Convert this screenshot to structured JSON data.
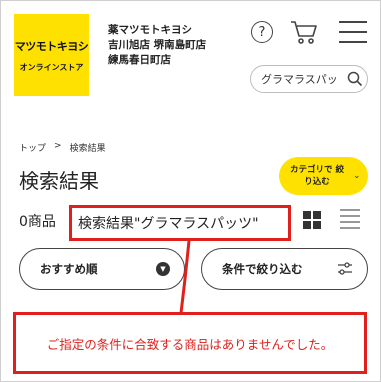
{
  "header": {
    "logo": {
      "brand": "マツモトキヨシ",
      "sub": "オンラインストア"
    },
    "store_lines": [
      "薬マツモトキヨシ",
      "吉川旭店 堺南島町店",
      "練馬春日町店"
    ],
    "icons": {
      "help": "help-icon",
      "cart": "cart-icon",
      "menu": "hamburger-menu-icon",
      "search": "search-icon"
    },
    "help_glyph": "?",
    "search": {
      "value": "グラマラスパッ"
    }
  },
  "breadcrumb": {
    "home": "トップ",
    "separator": ">",
    "current": "検索結果"
  },
  "title": "検索結果",
  "category_button": {
    "label": "カテゴリで 絞り込む",
    "chevron": "⌄"
  },
  "results": {
    "count": "0商品",
    "query_label": "検索結果\"グラマラスパッツ\""
  },
  "controls": {
    "sort_label": "おすすめ順",
    "filter_label": "条件で絞り込む"
  },
  "notice": "ご指定の条件に合致する商品はありませんでした。",
  "colors": {
    "brand_yellow": "#ffe100",
    "highlight_red": "#e0201c"
  }
}
